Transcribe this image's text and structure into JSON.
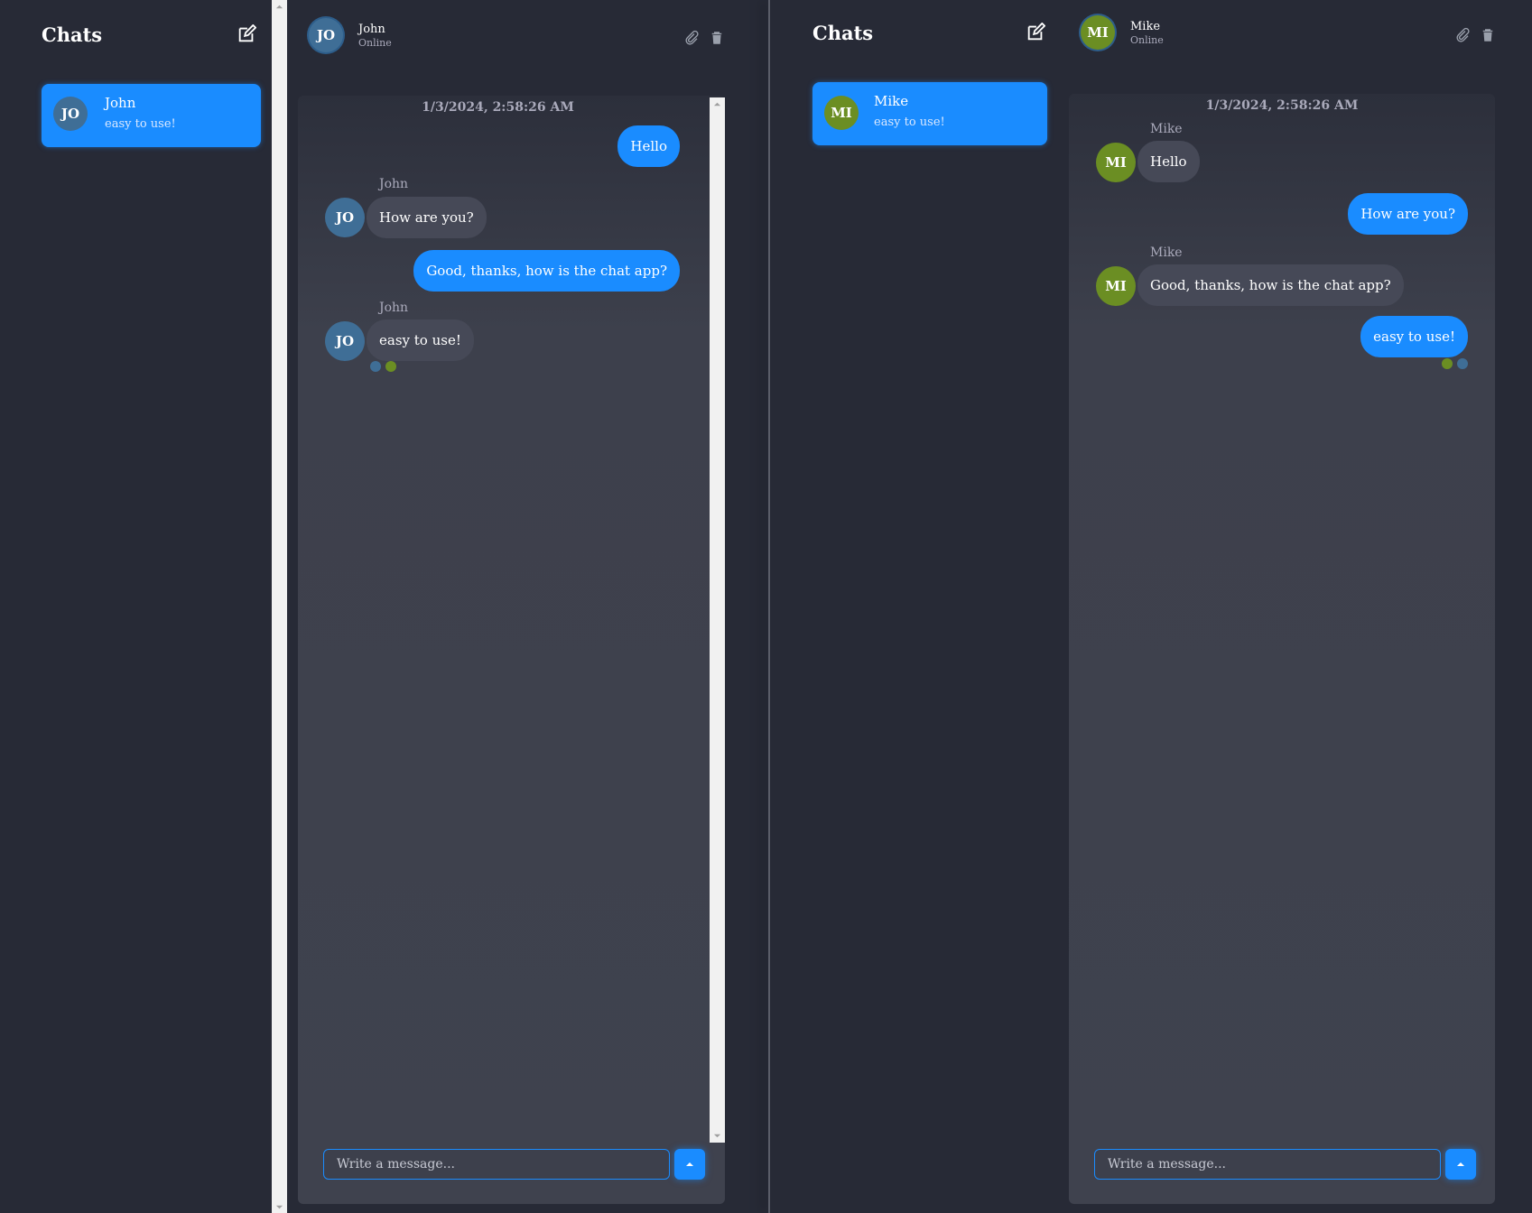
{
  "left": {
    "sidebar": {
      "title": "Chats",
      "chats": [
        {
          "initials": "JO",
          "name": "John",
          "last": "easy to use!"
        }
      ]
    },
    "header": {
      "initials": "JO",
      "name": "John",
      "status": "Online"
    },
    "timestamp": "1/3/2024, 2:58:26 AM",
    "messages": [
      {
        "dir": "out",
        "text": "Hello"
      },
      {
        "dir": "in",
        "sender": "John",
        "initials": "JO",
        "text": "How are you?"
      },
      {
        "dir": "out",
        "text": "Good, thanks, how is the chat app?"
      },
      {
        "dir": "in",
        "sender": "John",
        "initials": "JO",
        "text": "easy to use!"
      }
    ],
    "input": {
      "placeholder": "Write a message..."
    }
  },
  "right": {
    "sidebar": {
      "title": "Chats",
      "chats": [
        {
          "initials": "MI",
          "name": "Mike",
          "last": "easy to use!"
        }
      ]
    },
    "header": {
      "initials": "MI",
      "name": "Mike",
      "status": "Online"
    },
    "timestamp": "1/3/2024, 2:58:26 AM",
    "messages": [
      {
        "dir": "in",
        "sender": "Mike",
        "initials": "MI",
        "text": "Hello"
      },
      {
        "dir": "out",
        "text": "How are you?"
      },
      {
        "dir": "in",
        "sender": "Mike",
        "initials": "MI",
        "text": "Good, thanks, how is the chat app?"
      },
      {
        "dir": "out",
        "text": "easy to use!"
      }
    ],
    "input": {
      "placeholder": "Write a message..."
    }
  },
  "colors": {
    "accent": "#1a8cff",
    "john_avatar": "#3f6e96",
    "mike_avatar": "#6b8e23",
    "background": "#272a36"
  },
  "icons": [
    "compose-icon",
    "paperclip-icon",
    "trash-icon",
    "send-arrow-icon"
  ]
}
